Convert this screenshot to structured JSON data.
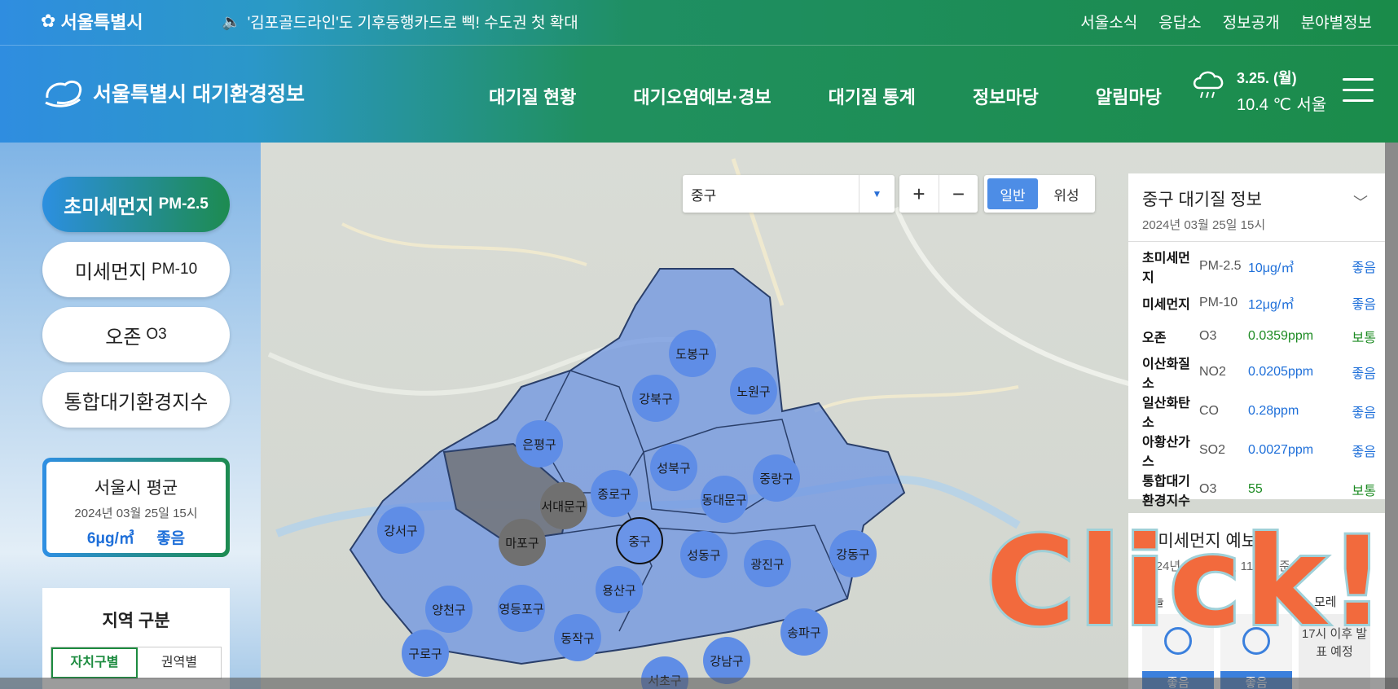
{
  "topbar": {
    "logo": "서울특별시",
    "notice": "'김포골드라인'도 기후동행카드로 삑! 수도권 첫 확대",
    "links": [
      "서울소식",
      "응답소",
      "정보공개",
      "분야별정보"
    ]
  },
  "header": {
    "brand": "서울특별시 대기환경정보",
    "nav": [
      "대기질 현황",
      "대기오염예보·경보",
      "대기질 통계",
      "정보마당",
      "알림마당"
    ],
    "weather": {
      "date": "3.25. (월)",
      "temp": "10.4 ℃",
      "city": "서울",
      "icon": "cloud-rain-icon"
    }
  },
  "left": {
    "pills": [
      {
        "label": "초미세먼지",
        "sub": "PM-2.5",
        "active": true
      },
      {
        "label": "미세먼지",
        "sub": "PM-10"
      },
      {
        "label": "오존",
        "sub": "O3"
      },
      {
        "label": "통합대기환경지수",
        "sub": ""
      }
    ],
    "avg": {
      "title": "서울시 평균",
      "date": "2024년 03월 25일 15시",
      "value": "6μg/㎥",
      "grade": "좋음"
    },
    "region": {
      "title": "지역 구분",
      "tabs": [
        "자치구별",
        "권역별"
      ]
    }
  },
  "map": {
    "select_value": "중구",
    "zoom_in": "+",
    "zoom_out": "−",
    "types": [
      "일반",
      "위성"
    ],
    "districts": [
      {
        "name": "도봉구"
      },
      {
        "name": "강북구"
      },
      {
        "name": "노원구"
      },
      {
        "name": "은평구"
      },
      {
        "name": "성북구"
      },
      {
        "name": "종로구"
      },
      {
        "name": "중랑구"
      },
      {
        "name": "동대문구"
      },
      {
        "name": "서대문구"
      },
      {
        "name": "강서구"
      },
      {
        "name": "마포구"
      },
      {
        "name": "중구"
      },
      {
        "name": "성동구"
      },
      {
        "name": "광진구"
      },
      {
        "name": "강동구"
      },
      {
        "name": "용산구"
      },
      {
        "name": "양천구"
      },
      {
        "name": "영등포구"
      },
      {
        "name": "동작구"
      },
      {
        "name": "구로구"
      },
      {
        "name": "송파구"
      },
      {
        "name": "강남구"
      },
      {
        "name": "서초구"
      }
    ]
  },
  "info": {
    "title": "중구 대기질 정보",
    "date": "2024년 03월 25일 15시",
    "rows": [
      {
        "name": "초미세먼지",
        "sym": "PM-2.5",
        "value": "10μg/㎥",
        "grade": "좋음"
      },
      {
        "name": "미세먼지",
        "sym": "PM-10",
        "value": "12μg/㎥",
        "grade": "좋음"
      },
      {
        "name": "오존",
        "sym": "O3",
        "value": "0.0359ppm",
        "grade": "보통"
      },
      {
        "name": "이산화질소",
        "sym": "NO2",
        "value": "0.0205ppm",
        "grade": "좋음"
      },
      {
        "name": "일산화탄소",
        "sym": "CO",
        "value": "0.28ppm",
        "grade": "좋음"
      },
      {
        "name": "아황산가스",
        "sym": "SO2",
        "value": "0.0027ppm",
        "grade": "좋음"
      },
      {
        "name": "통합대기 환경지수",
        "sym": "O3",
        "value": "55",
        "grade": "보통"
      }
    ]
  },
  "forecast": {
    "title": "초미세먼지 예보",
    "date": "2024년 03월 25일 11시 기준",
    "col_left": "늘",
    "col_right": "모레",
    "cards": [
      {
        "grade": "좋음"
      },
      {
        "grade": "좋음"
      }
    ],
    "pending": "17시 이후 발표 예정"
  },
  "overlay": {
    "text": "Click!"
  }
}
